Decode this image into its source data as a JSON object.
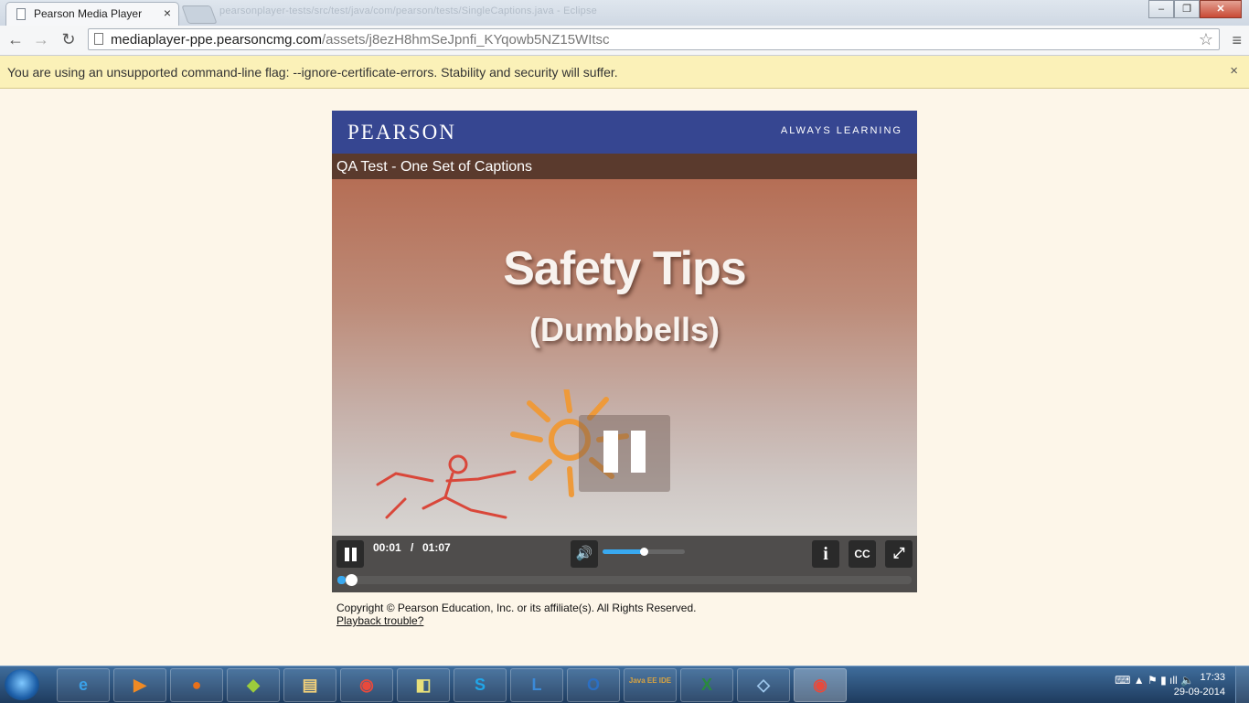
{
  "browser": {
    "tab_title": "Pearson Media Player",
    "tab_close": "×",
    "background_window_title": "pearsonplayer-tests/src/test/java/com/pearson/tests/SingleCaptions.java - Eclipse",
    "url_host": "mediaplayer-ppe.pearsoncmg.com",
    "url_path": "/assets/j8ezH8hmSeJpnfi_KYqowb5NZ15WItsc",
    "back_icon": "←",
    "forward_icon": "→",
    "reload_icon": "↻",
    "star_icon": "☆",
    "menu_icon": "≡"
  },
  "infobar": {
    "message": "You are using an unsupported command-line flag: --ignore-certificate-errors. Stability and security will suffer.",
    "close": "×"
  },
  "player": {
    "brand": "PEARSON",
    "tagline": "ALWAYS LEARNING",
    "title": "QA Test - One Set of Captions",
    "video_text_line1": "Safety Tips",
    "video_text_line2": "(Dumbbells)",
    "current_time": "00:01",
    "time_separator": "/",
    "duration": "01:07",
    "volume_level": 0.5,
    "progress_fraction": 0.015,
    "info_label": "i",
    "cc_label": "CC",
    "fullscreen_icon": "⤢",
    "volume_icon": "🔊"
  },
  "footer": {
    "copyright": "Copyright © Pearson Education, Inc. or its affiliate(s). All Rights Reserved.",
    "help_link": "Playback trouble?"
  },
  "taskbar": {
    "apps": [
      {
        "name": "internet-explorer",
        "glyph": "e",
        "color": "#3aa0e8"
      },
      {
        "name": "media-player",
        "glyph": "▶",
        "color": "#f08a24"
      },
      {
        "name": "firefox",
        "glyph": "●",
        "color": "#e8701a"
      },
      {
        "name": "android",
        "glyph": "◆",
        "color": "#9ccc3c"
      },
      {
        "name": "file-explorer",
        "glyph": "▤",
        "color": "#f4d27a"
      },
      {
        "name": "chrome",
        "glyph": "◉",
        "color": "#e84a3c"
      },
      {
        "name": "notes",
        "glyph": "◧",
        "color": "#e8e07a"
      },
      {
        "name": "skype",
        "glyph": "S",
        "color": "#21a6e8"
      },
      {
        "name": "lync",
        "glyph": "L",
        "color": "#3b8ad8"
      },
      {
        "name": "outlook",
        "glyph": "O",
        "color": "#2b6fc4"
      },
      {
        "name": "eclipse",
        "glyph": "Java EE IDE",
        "color": "#d9a441"
      },
      {
        "name": "excel",
        "glyph": "X",
        "color": "#2a8a3e"
      },
      {
        "name": "gadget",
        "glyph": "◇",
        "color": "#9ec7ec"
      },
      {
        "name": "chrome-active",
        "glyph": "◉",
        "color": "#e84a3c"
      }
    ],
    "tray_icons": "⌨ ▲ ⚑ ▮ ıll 🔈",
    "clock_time": "17:33",
    "clock_date": "29-09-2014"
  }
}
